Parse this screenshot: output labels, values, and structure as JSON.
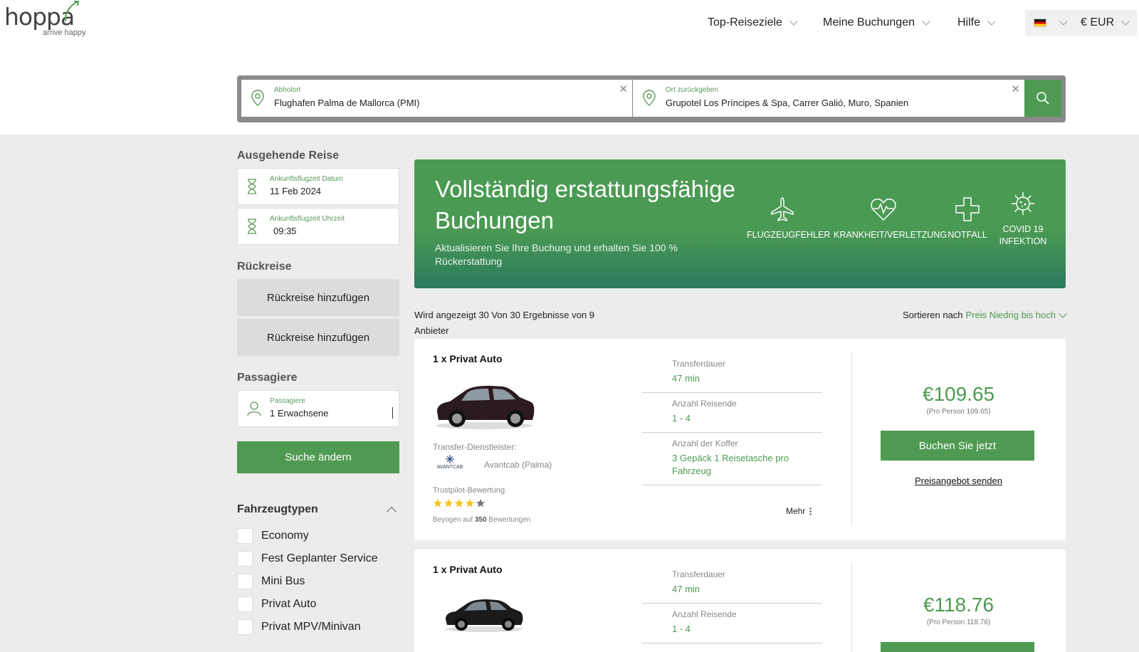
{
  "header": {
    "logo_text": "hoppa",
    "logo_tagline": "arrive happy",
    "nav": [
      {
        "label": "Top-Reiseziele"
      },
      {
        "label": "Meine Buchungen"
      },
      {
        "label": "Hilfe"
      }
    ],
    "currency": "€ EUR"
  },
  "search": {
    "pickup_label": "Abholort",
    "pickup_value": "Flughafen Palma de Mallorca (PMI)",
    "return_label": "Ort zurückgeben",
    "return_value": "Grupotel Los Príncipes & Spa, Carrer Galió, Muro, Spanien"
  },
  "sidebar": {
    "outbound_title": "Ausgehende Reise",
    "date_label": "Ankunftsflugzeit Datum",
    "date_value": "11 Feb 2024",
    "time_label": "Ankunftsflugzeit Uhrzeit",
    "time_value": "09:35",
    "return_title": "Rückreise",
    "add_return_1": "Rückreise hinzufügen",
    "add_return_2": "Rückreise hinzufügen",
    "passengers_title": "Passagiere",
    "passengers_label": "Passagiere",
    "passengers_value": "1 Erwachsene",
    "change_search": "Suche ändern",
    "vehicle_types_title": "Fahrzeugtypen",
    "vehicle_types": [
      "Economy",
      "Fest Geplanter Service",
      "Mini Bus",
      "Privat Auto",
      "Privat MPV/Minivan"
    ]
  },
  "banner": {
    "title": "Vollständig erstattungsfähige Buchungen",
    "subtitle": "Aktualisieren Sie Ihre Buchung und erhalten Sie 100 % Rückerstattung",
    "icons": [
      {
        "label": "FLUGZEUGFEHLER",
        "icon": "airplane-icon"
      },
      {
        "label": "KRANKHEIT/VERLETZUNG",
        "icon": "heartbeat-icon"
      },
      {
        "label": "NOTFALL",
        "icon": "cross-icon"
      },
      {
        "label": "COVID 19 INFEKTION",
        "icon": "virus-icon"
      }
    ]
  },
  "results": {
    "line1": "Wird angezeigt 30 Von 30 Ergebnisse von 9",
    "line2": "Anbieter",
    "sort_label": "Sortieren nach",
    "sort_value": "Preis Niedrig bis hoch"
  },
  "cards": [
    {
      "title": "1 x Privat Auto",
      "provider_label": "Transfer-Dienstleister:",
      "provider_name": "Avantcab (Palma)",
      "provider_logo_text": "AVANTCAB",
      "trustpilot_label": "Trustpilot-Bewertung",
      "rating": 4,
      "reviews_prefix": "Beyogen auf",
      "reviews_count": "350",
      "reviews_suffix": "Bewertungen",
      "duration_label": "Transferdauer",
      "duration_value": "47 min",
      "pax_label": "Anzahl Reisende",
      "pax_value": "1 - 4",
      "bags_label": "Anzahl der Koffer",
      "bags_value": "3 Gepäck 1 Reisetasche pro Fahrzeug",
      "more": "Mehr",
      "price": "€109.65",
      "per_person": "(Pro Person 109.65)",
      "book": "Buchen Sie jetzt",
      "quote": "Preisangebot senden"
    },
    {
      "title": "1 x Privat Auto",
      "duration_label": "Transferdauer",
      "duration_value": "47 min",
      "pax_label": "Anzahl Reisende",
      "pax_value": "1 - 4",
      "price": "€118.76",
      "per_person": "(Pro Person 118.76)"
    }
  ]
}
